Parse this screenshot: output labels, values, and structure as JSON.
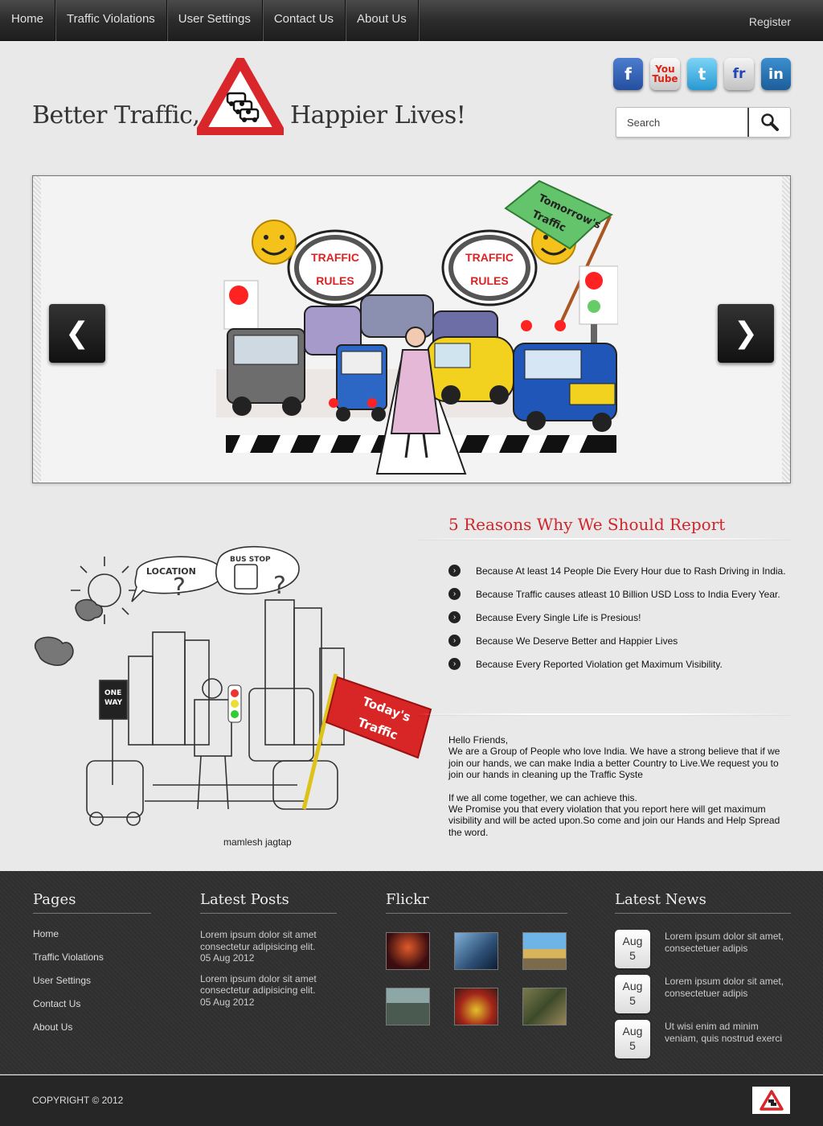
{
  "nav": {
    "items": [
      "Home",
      "Traffic Violations",
      "User Settings",
      "Contact Us",
      "About Us"
    ],
    "register": "Register"
  },
  "header": {
    "tagline_left": "Better Traffic,",
    "tagline_right": "Happier Lives!",
    "social": [
      {
        "icon": "facebook-icon",
        "glyph": "f"
      },
      {
        "icon": "youtube-icon",
        "glyph": "You\nTube"
      },
      {
        "icon": "twitter-icon",
        "glyph": "t"
      },
      {
        "icon": "friendfeed-icon",
        "glyph": "fr"
      },
      {
        "icon": "linkedin-icon",
        "glyph": "in"
      }
    ],
    "search_placeholder": "Search"
  },
  "slider": {
    "prev": "❮",
    "next": "❯",
    "art_labels": {
      "flag": "Tomorrow's Traffic",
      "bubble": "TRAFFIC RULES"
    }
  },
  "middle": {
    "illustration_labels": {
      "bubble1": "LOCATION",
      "bubble2": "BUS STOP",
      "sign": "ONE WAY",
      "flag": "Today's Traffic"
    },
    "caption": "mamlesh jagtap",
    "reasons_title": "5 Reasons Why We Should Report",
    "reasons": [
      "Because At least 14 People Die Every Hour due to Rash Driving in India.",
      "Because Traffic causes atleast 10 Billion USD Loss to India Every Year.",
      "Because Every Single Life is Presious!",
      "Because We Deserve Better and Happier Lives",
      "Because Every Reported Violation get Maximum Visibility."
    ],
    "about_p1": "Hello Friends,\nWe are a Group of People who love India. We have a strong believe that if we join our hands, we can make India a better Country to Live.We request you to join our hands in cleaning up the Traffic Syste",
    "about_p2": "If we all come together, we can achieve this.\nWe Promise you that every violation that you report here will get maximum visibility and will be acted upon.So come and join our Hands and Help Spread the word."
  },
  "footer": {
    "pages_title": "Pages",
    "pages": [
      "Home",
      "Traffic Violations",
      "User Settings",
      "Contact Us",
      "About Us"
    ],
    "posts_title": "Latest Posts",
    "posts": [
      {
        "text": "Lorem ipsum dolor sit amet consectetur adipisicing elit.",
        "date": "05 Aug 2012"
      },
      {
        "text": "Lorem ipsum dolor sit amet consectetur adipisicing elit.",
        "date": "05 Aug 2012"
      }
    ],
    "flickr_title": "Flickr",
    "flickr_colors": [
      "#5a2020",
      "#3f6c8f",
      "#b59a57",
      "#465b4c",
      "#8a3a2c",
      "#6b6a45"
    ],
    "news_title": "Latest News",
    "news": [
      {
        "month": "Aug",
        "day": "5",
        "text": "Lorem ipsum dolor sit amet, consectetuer adipis"
      },
      {
        "month": "Aug",
        "day": "5",
        "text": "Lorem ipsum dolor sit amet, consectetuer adipis"
      },
      {
        "month": "Aug",
        "day": "5",
        "text": "Ut wisi enim ad minim veniam, quis nostrud exerci"
      }
    ],
    "copyright": "COPYRIGHT © 2012"
  },
  "colors": {
    "accent_red": "#d0252a",
    "nav_bg": "#2c2c2c",
    "footer_bg": "#2f2f2f"
  }
}
